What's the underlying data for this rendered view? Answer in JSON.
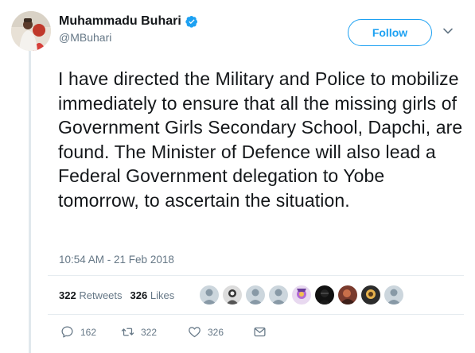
{
  "author": {
    "display_name": "Muhammadu Buhari",
    "handle": "@MBuhari",
    "verified": true
  },
  "follow_label": "Follow",
  "tweet": {
    "text": "I have directed the Military and Police to mobilize immediately to ensure that all the missing girls of Government Girls Secondary School, Dapchi, are found. The Minister of Defence will also lead a Federal Government delegation to Yobe tomorrow, to ascertain the situation.",
    "timestamp": "10:54 AM - 21 Feb 2018"
  },
  "stats": {
    "retweets_count": "322",
    "retweets_label": "Retweets",
    "likes_count": "326",
    "likes_label": "Likes"
  },
  "actions": {
    "reply_count": "162",
    "retweet_count": "322",
    "like_count": "326"
  },
  "icons": {
    "verified": "verified-badge-icon",
    "menu": "chevron-down-icon",
    "reply": "reply-icon",
    "retweet": "retweet-icon",
    "like": "heart-icon",
    "dm": "envelope-icon"
  },
  "colors": {
    "accent": "#1da1f2",
    "text": "#14171a",
    "muted": "#657786",
    "rule": "#e1e8ed"
  }
}
